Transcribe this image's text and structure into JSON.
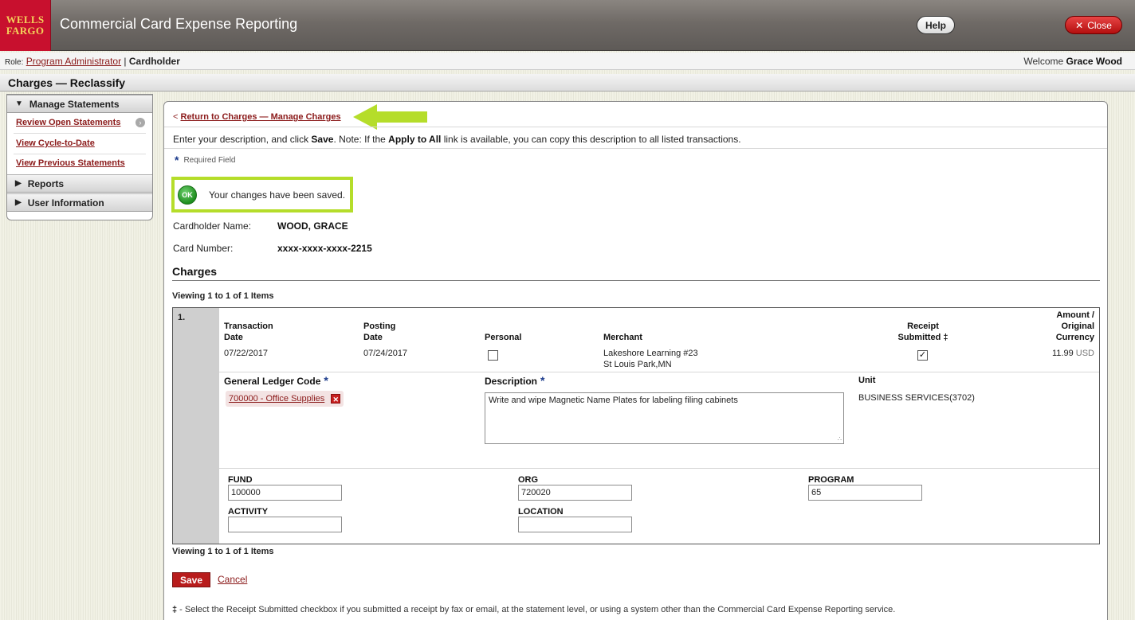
{
  "header": {
    "logo_line1": "WELLS",
    "logo_line2": "FARGO",
    "app_title": "Commercial Card Expense Reporting",
    "help_label": "Help",
    "close_label": "Close",
    "close_icon": "✕"
  },
  "rolebar": {
    "role_label": "Role:",
    "role_link": "Program Administrator",
    "separator": "|",
    "role_current": "Cardholder",
    "welcome_prefix": "Welcome",
    "welcome_name": "Grace Wood"
  },
  "page_title": "Charges — Reclassify",
  "leftnav": {
    "manage_statements": "Manage Statements",
    "items": [
      {
        "label": "Review Open Statements"
      },
      {
        "label": "View Cycle-to-Date"
      },
      {
        "label": "View Previous Statements"
      }
    ],
    "reports": "Reports",
    "user_information": "User Information"
  },
  "main": {
    "return_prefix": "<",
    "return_link": "Return to Charges — Manage Charges",
    "instr_1": "Enter your description, and click ",
    "instr_save": "Save",
    "instr_2": ". Note: If the ",
    "instr_apply": "Apply to All",
    "instr_3": " link is available, you can copy this description to all listed transactions.",
    "required_star": "*",
    "required_label": "Required Field",
    "ok_icon": "OK",
    "saved_message": "Your changes have been saved.",
    "cardholder_label": "Cardholder Name:",
    "cardholder_value": "WOOD, GRACE",
    "card_label": "Card Number:",
    "card_value": "xxxx-xxxx-xxxx-2215",
    "section_title": "Charges",
    "viewing": "Viewing 1 to 1 of 1 Items"
  },
  "charge": {
    "num": "1.",
    "h_trans_1": "Transaction",
    "h_trans_2": "Date",
    "h_post_1": "Posting",
    "h_post_2": "Date",
    "h_personal": "Personal",
    "h_merchant": "Merchant",
    "h_receipt_1": "Receipt",
    "h_receipt_2": "Submitted ‡",
    "h_amount_1": "Amount /",
    "h_amount_2": "Original",
    "h_amount_3": "Currency",
    "trans_date": "07/22/2017",
    "post_date": "07/24/2017",
    "personal_checked": false,
    "merchant_1": "Lakeshore Learning #23",
    "merchant_2": "St Louis Park,MN",
    "receipt_checked": true,
    "receipt_mark": "✓",
    "amount": "11.99",
    "currency": "USD",
    "gl_label": "General Ledger Code",
    "gl_value": "700000 - Office Supplies",
    "remove_icon": "✕",
    "desc_label": "Description",
    "desc_value": "Write and wipe Magnetic Name Plates for labeling filing cabinets",
    "unit_label": "Unit",
    "unit_value": "BUSINESS SERVICES(3702)",
    "resize_glyph": "∴",
    "fund_label": "FUND",
    "fund_value": "100000",
    "org_label": "ORG",
    "org_value": "720020",
    "program_label": "PROGRAM",
    "program_value": "65",
    "activity_label": "ACTIVITY",
    "activity_value": "",
    "location_label": "LOCATION",
    "location_value": ""
  },
  "footer": {
    "save_label": "Save",
    "cancel_label": "Cancel",
    "footnote_mark": "‡",
    "footnote_text": " - Select the Receipt Submitted checkbox if you submitted a receipt by fax or email, at the statement level, or using a system other than the Commercial Card Expense Reporting service."
  },
  "colors": {
    "brand_red": "#c8102e",
    "highlight_green": "#b5dd2a",
    "link_red": "#8b1a1a"
  },
  "icons": [
    "close-icon",
    "go-icon",
    "ok-icon",
    "remove-icon",
    "callout-arrow-icon",
    "required-star-icon"
  ]
}
